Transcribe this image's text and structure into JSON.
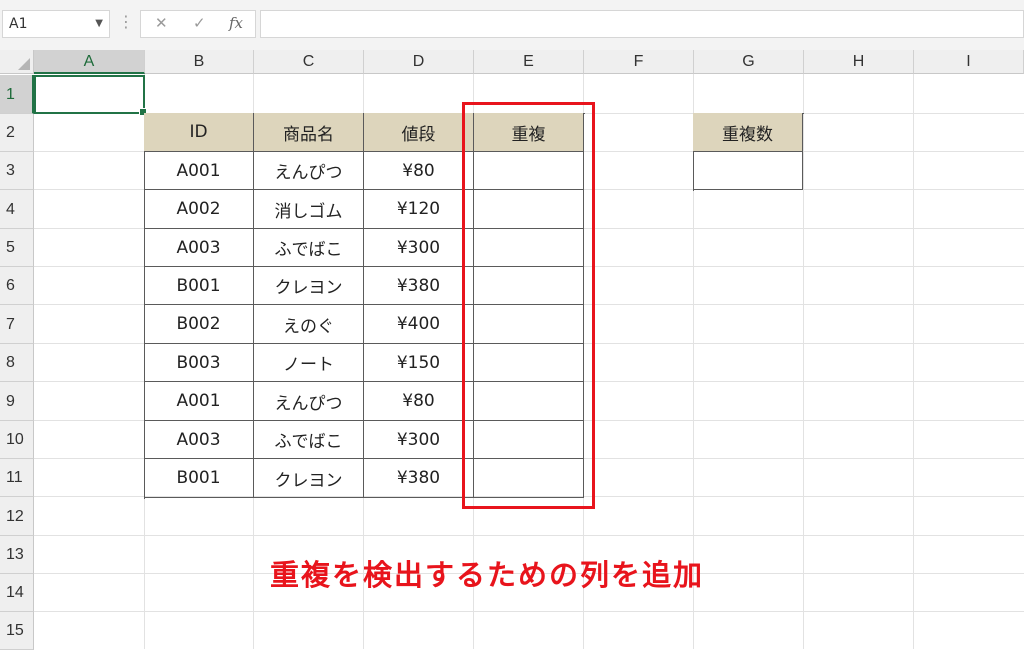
{
  "formula_bar": {
    "name_box": "A1",
    "cancel_icon": "✕",
    "enter_icon": "✓",
    "fx_label": "fx",
    "formula": ""
  },
  "columns": [
    "A",
    "B",
    "C",
    "D",
    "E",
    "F",
    "G",
    "H",
    "I"
  ],
  "rows": [
    "1",
    "2",
    "3",
    "4",
    "5",
    "6",
    "7",
    "8",
    "9",
    "10",
    "11",
    "12",
    "13",
    "14",
    "15"
  ],
  "selected": {
    "column": "A",
    "row": "1"
  },
  "table": {
    "headers": [
      "ID",
      "商品名",
      "値段",
      "重複"
    ],
    "rows": [
      [
        "A001",
        "えんぴつ",
        "¥80",
        ""
      ],
      [
        "A002",
        "消しゴム",
        "¥120",
        ""
      ],
      [
        "A003",
        "ふでばこ",
        "¥300",
        ""
      ],
      [
        "B001",
        "クレヨン",
        "¥380",
        ""
      ],
      [
        "B002",
        "えのぐ",
        "¥400",
        ""
      ],
      [
        "B003",
        "ノート",
        "¥150",
        ""
      ],
      [
        "A001",
        "えんぴつ",
        "¥80",
        ""
      ],
      [
        "A003",
        "ふでばこ",
        "¥300",
        ""
      ],
      [
        "B001",
        "クレヨン",
        "¥380",
        ""
      ]
    ]
  },
  "count_table": {
    "header": "重複数",
    "value": ""
  },
  "annotation": "重複を検出するための列を追加",
  "colors": {
    "header_fill": "#ddd5bc",
    "highlight_red": "#e8141c",
    "excel_green": "#217346"
  }
}
